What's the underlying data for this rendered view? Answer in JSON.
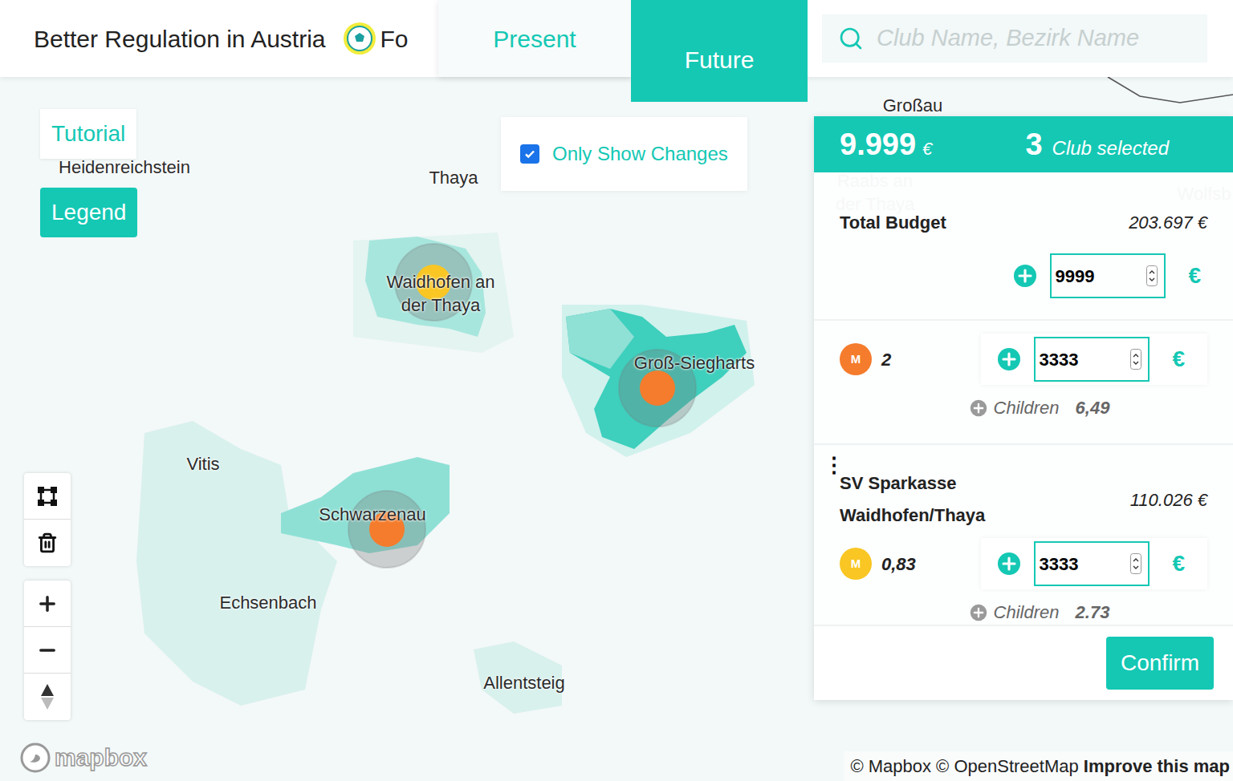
{
  "header": {
    "title": "Better Regulation in Austria",
    "logo_text": "Fo"
  },
  "tabs": [
    {
      "label": "Present",
      "selected": false
    },
    {
      "label": "Future",
      "selected": true
    }
  ],
  "search": {
    "placeholder": "Club Name, Bezirk Name"
  },
  "buttons": {
    "tutorial": "Tutorial",
    "legend": "Legend"
  },
  "filter": {
    "label": "Only Show Changes",
    "checked": true
  },
  "map": {
    "labels": [
      {
        "text": "Großau",
        "faint": false
      },
      {
        "text": "Heidenreichstein",
        "faint": false
      },
      {
        "text": "Thaya",
        "faint": false
      },
      {
        "text": "Waidhofen an der Thaya",
        "faint": false
      },
      {
        "text": "Groß-Siegharts",
        "faint": false
      },
      {
        "text": "Vitis",
        "faint": false
      },
      {
        "text": "Schwarzenau",
        "faint": false
      },
      {
        "text": "Echsenbach",
        "faint": false
      },
      {
        "text": "Allentsteig",
        "faint": false
      },
      {
        "text": "Raabs an der Thaya",
        "faint": true
      },
      {
        "text": "Wolfsb",
        "faint": true
      }
    ],
    "markers": [
      {
        "name": "Waidhofen an der Thaya",
        "color": "#f9c623"
      },
      {
        "name": "Groß-Siegharts",
        "color": "#f47c2c"
      },
      {
        "name": "Schwarzenau",
        "color": "#f47c2c"
      }
    ],
    "logo": "mapbox",
    "attribution": {
      "text": "© Mapbox © OpenStreetMap",
      "link": "Improve this map"
    }
  },
  "panel": {
    "total": "9.999",
    "currency": "€",
    "selected_count": "3",
    "selected_label": "Club selected",
    "budget": {
      "label": "Total Budget",
      "amount": "203.697 €",
      "value": "9999",
      "unit": "€"
    },
    "clubs": [
      {
        "menu": "",
        "name": "",
        "amount": "",
        "badge": "M",
        "score": "2",
        "color": "#f47c2c",
        "value": "3333",
        "unit": "€",
        "children_label": "Children",
        "children": "6,49"
      },
      {
        "menu": "⋮",
        "name": "SV Sparkasse Waidhofen/Thaya",
        "amount": "110.026 €",
        "badge": "M",
        "score": "0,83",
        "color": "#f9c623",
        "value": "3333",
        "unit": "€",
        "children_label": "Children",
        "children": "2.73"
      }
    ],
    "confirm": "Confirm"
  }
}
